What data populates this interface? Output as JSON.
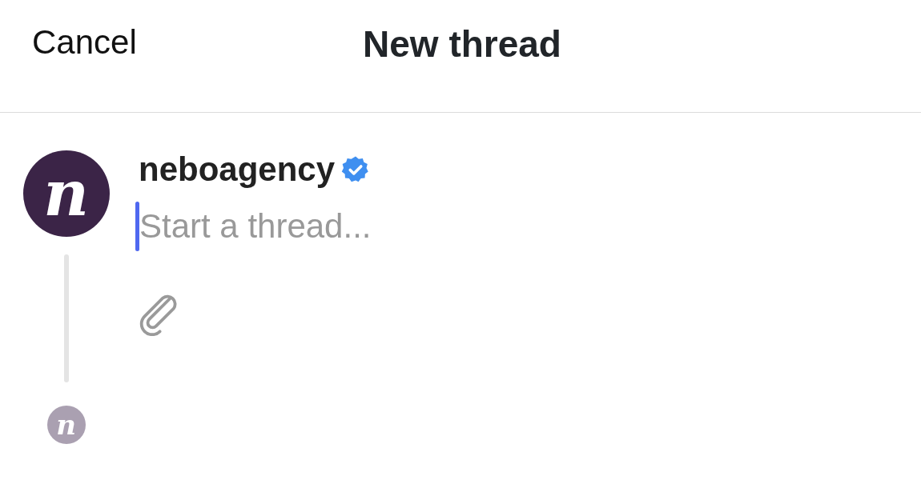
{
  "header": {
    "cancel": "Cancel",
    "title": "New thread"
  },
  "composer": {
    "avatar": {
      "letter": "n"
    },
    "username": "neboagency",
    "verified": true,
    "placeholder": "Start a thread...",
    "focused": true
  },
  "reply_avatar": {
    "letter": "n"
  }
}
